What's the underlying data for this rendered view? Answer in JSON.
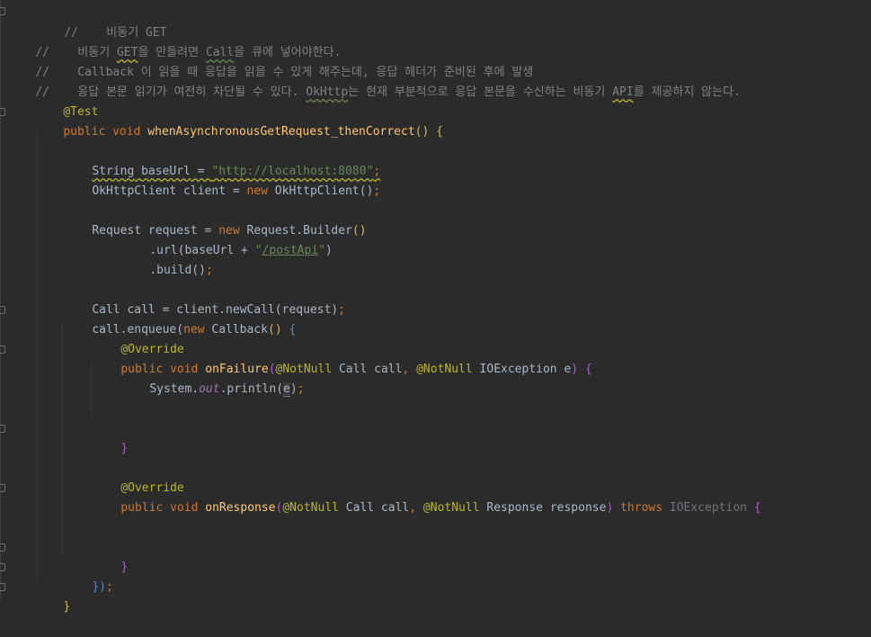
{
  "code": {
    "l1": {
      "slashes": "//",
      "text": "    비동기 GET"
    },
    "l2": {
      "slashes": "//",
      "a": "    비동기 ",
      "b": "GET",
      "c": "을 만들려면 ",
      "d": "Call",
      "e": "을 큐에 넣어야한다."
    },
    "l3": {
      "slashes": "//",
      "text": "    Callback 이 읽을 때 응답을 읽을 수 있게 해주는데, 응답 헤더가 준비된 후에 발생"
    },
    "l4": {
      "slashes": "//",
      "a": "    응답 본문 읽기가 여전히 차단될 수 있다. ",
      "b": "OkHttp",
      "c": "는 현재 부분적으로 응답 본문을 수신하는 비동기 ",
      "d": "API",
      "e": "를 제공하지 않는다."
    },
    "l5": {
      "annotation": "@Test"
    },
    "l6": {
      "kw1": "public",
      "kw2": "void",
      "method": "whenAsynchronousGetRequest_thenCorrect",
      "paren": "()",
      "brace": "{"
    },
    "l8": {
      "type": "String",
      "var": "baseUrl",
      "eq": " = ",
      "str": "\"http://localhost:8080\"",
      "semi": ";"
    },
    "l9": {
      "a": "OkHttpClient client = ",
      "kw": "new",
      "b": " OkHttpClient()",
      "semi": ";"
    },
    "l11": {
      "a": "Request request = ",
      "kw": "new",
      "b": " Request.Builder",
      "paren": "()"
    },
    "l12": {
      "a": ".url(baseUrl + ",
      "q1": "\"",
      "path": "/postApi",
      "q2": "\"",
      "c": ")"
    },
    "l13": {
      "a": ".build()",
      "semi": ";"
    },
    "l15": {
      "a": "Call call = client.newCall(request)",
      "semi": ";"
    },
    "l16": {
      "a": "call.enqueue(",
      "kw": "new",
      "b": " Callback",
      "paren": "()",
      "brace": "{"
    },
    "l17": {
      "annotation": "@Override"
    },
    "l18": {
      "kw1": "public",
      "kw2": "void",
      "method": "onFailure",
      "p1": "(",
      "ann1": "@NotNull",
      "a": " Call call",
      "comma": ",",
      "ann2": "@NotNull",
      "b": " IOException e",
      "p2": ")",
      "brace": "{"
    },
    "l19": {
      "a": "System.",
      "field": "out",
      "b": ".println(",
      "caret": "e",
      "c": ")",
      "semi": ";"
    },
    "l22": {
      "brace": "}"
    },
    "l24": {
      "annotation": "@Override"
    },
    "l25": {
      "kw1": "public",
      "kw2": "void",
      "method": "onResponse",
      "p1": "(",
      "ann1": "@NotNull",
      "a": " Call call",
      "comma": ",",
      "ann2": "@NotNull",
      "b": " Response response",
      "p2": ")",
      "kw3": "throws",
      "exc": "IOException",
      "brace": "{"
    },
    "l28": {
      "brace": "}"
    },
    "l29": {
      "a": "})",
      "semi": ";"
    },
    "l30": {
      "brace": "}"
    }
  }
}
